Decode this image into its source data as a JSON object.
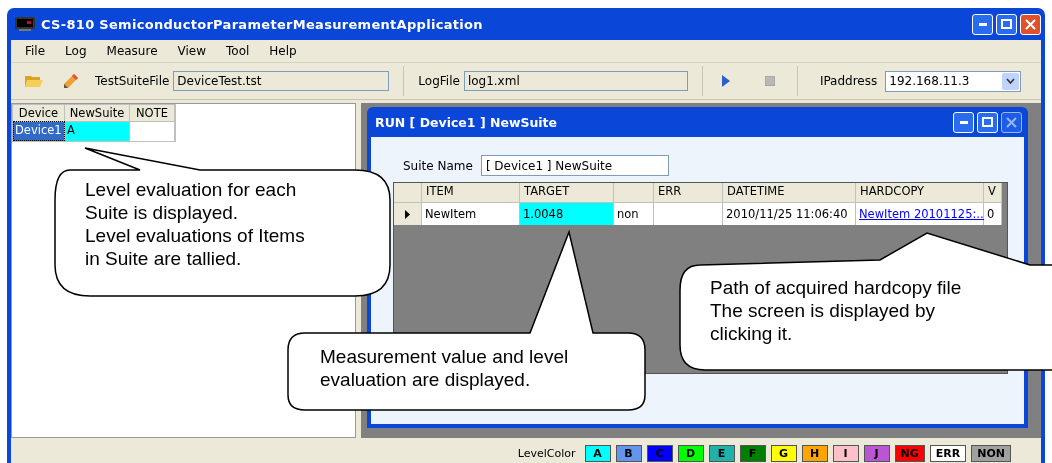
{
  "window": {
    "title": "CS-810 SemiconductorParameterMeasurementApplication"
  },
  "menu": [
    "File",
    "Log",
    "Measure",
    "View",
    "Tool",
    "Help"
  ],
  "toolbar": {
    "test_suite_file": {
      "label": "TestSuiteFile",
      "value": "DeviceTest.tst"
    },
    "log_file": {
      "label": "LogFile",
      "value": "log1.xml"
    },
    "ip_address": {
      "label": "IPaddress",
      "value": "192.168.11.3"
    }
  },
  "device_table": {
    "columns": [
      "Device",
      "NewSuite",
      "NOTE"
    ],
    "rows": [
      {
        "device": "Device1",
        "selected": true,
        "suite": "A",
        "color": "#00ffff"
      }
    ]
  },
  "run_window": {
    "title": "RUN [ Device1 ] NewSuite",
    "suite_name": {
      "label": "Suite Name",
      "value": "[ Device1 ] NewSuite"
    },
    "columns": [
      {
        "label": "ITEM"
      },
      {
        "label": "TARGET"
      },
      {},
      {
        "label": "ERR"
      },
      {
        "label": "DATETIME"
      },
      {
        "label": "HARDCOPY"
      },
      {
        "label": "V"
      }
    ],
    "rows": [
      {
        "current": true,
        "cells": [
          {
            "text": "NewItem"
          },
          {
            "text": "1.0048",
            "color": "#00ffff"
          },
          {
            "text": "non"
          },
          {},
          {
            "text": "2010/11/25 11:06:40"
          },
          {
            "text": "NewItem 20101125:...",
            "kind": "link"
          },
          {
            "text": "0"
          }
        ]
      }
    ]
  },
  "status_bar": {
    "label": "LevelColor",
    "levels": [
      {
        "name": "A",
        "color": "#00ffff"
      },
      {
        "name": "B",
        "color": "#6495ed"
      },
      {
        "name": "C",
        "color": "#0000ff"
      },
      {
        "name": "D",
        "color": "#00ff00"
      },
      {
        "name": "E",
        "color": "#20b2aa"
      },
      {
        "name": "F",
        "color": "#008000"
      },
      {
        "name": "G",
        "color": "#ffff00"
      },
      {
        "name": "H",
        "color": "#ffa500"
      },
      {
        "name": "I",
        "color": "#ffc0cb"
      },
      {
        "name": "J",
        "color": "#ba55d3"
      },
      {
        "name": "NG",
        "color": "#ff0000"
      },
      {
        "name": "ERR",
        "color": "#ffffff"
      },
      {
        "name": "NON",
        "color": "#a0a0a0"
      }
    ]
  },
  "callouts": [
    {
      "lines": [
        "Level evaluation for each",
        "Suite is displayed.",
        "Level evaluations of Items",
        "in Suite are tallied."
      ]
    },
    {
      "lines": [
        "Measurement value and level",
        "evaluation are displayed."
      ]
    },
    {
      "lines": [
        "Path of acquired hardcopy file",
        "The screen is displayed by",
        "clicking it."
      ]
    }
  ]
}
